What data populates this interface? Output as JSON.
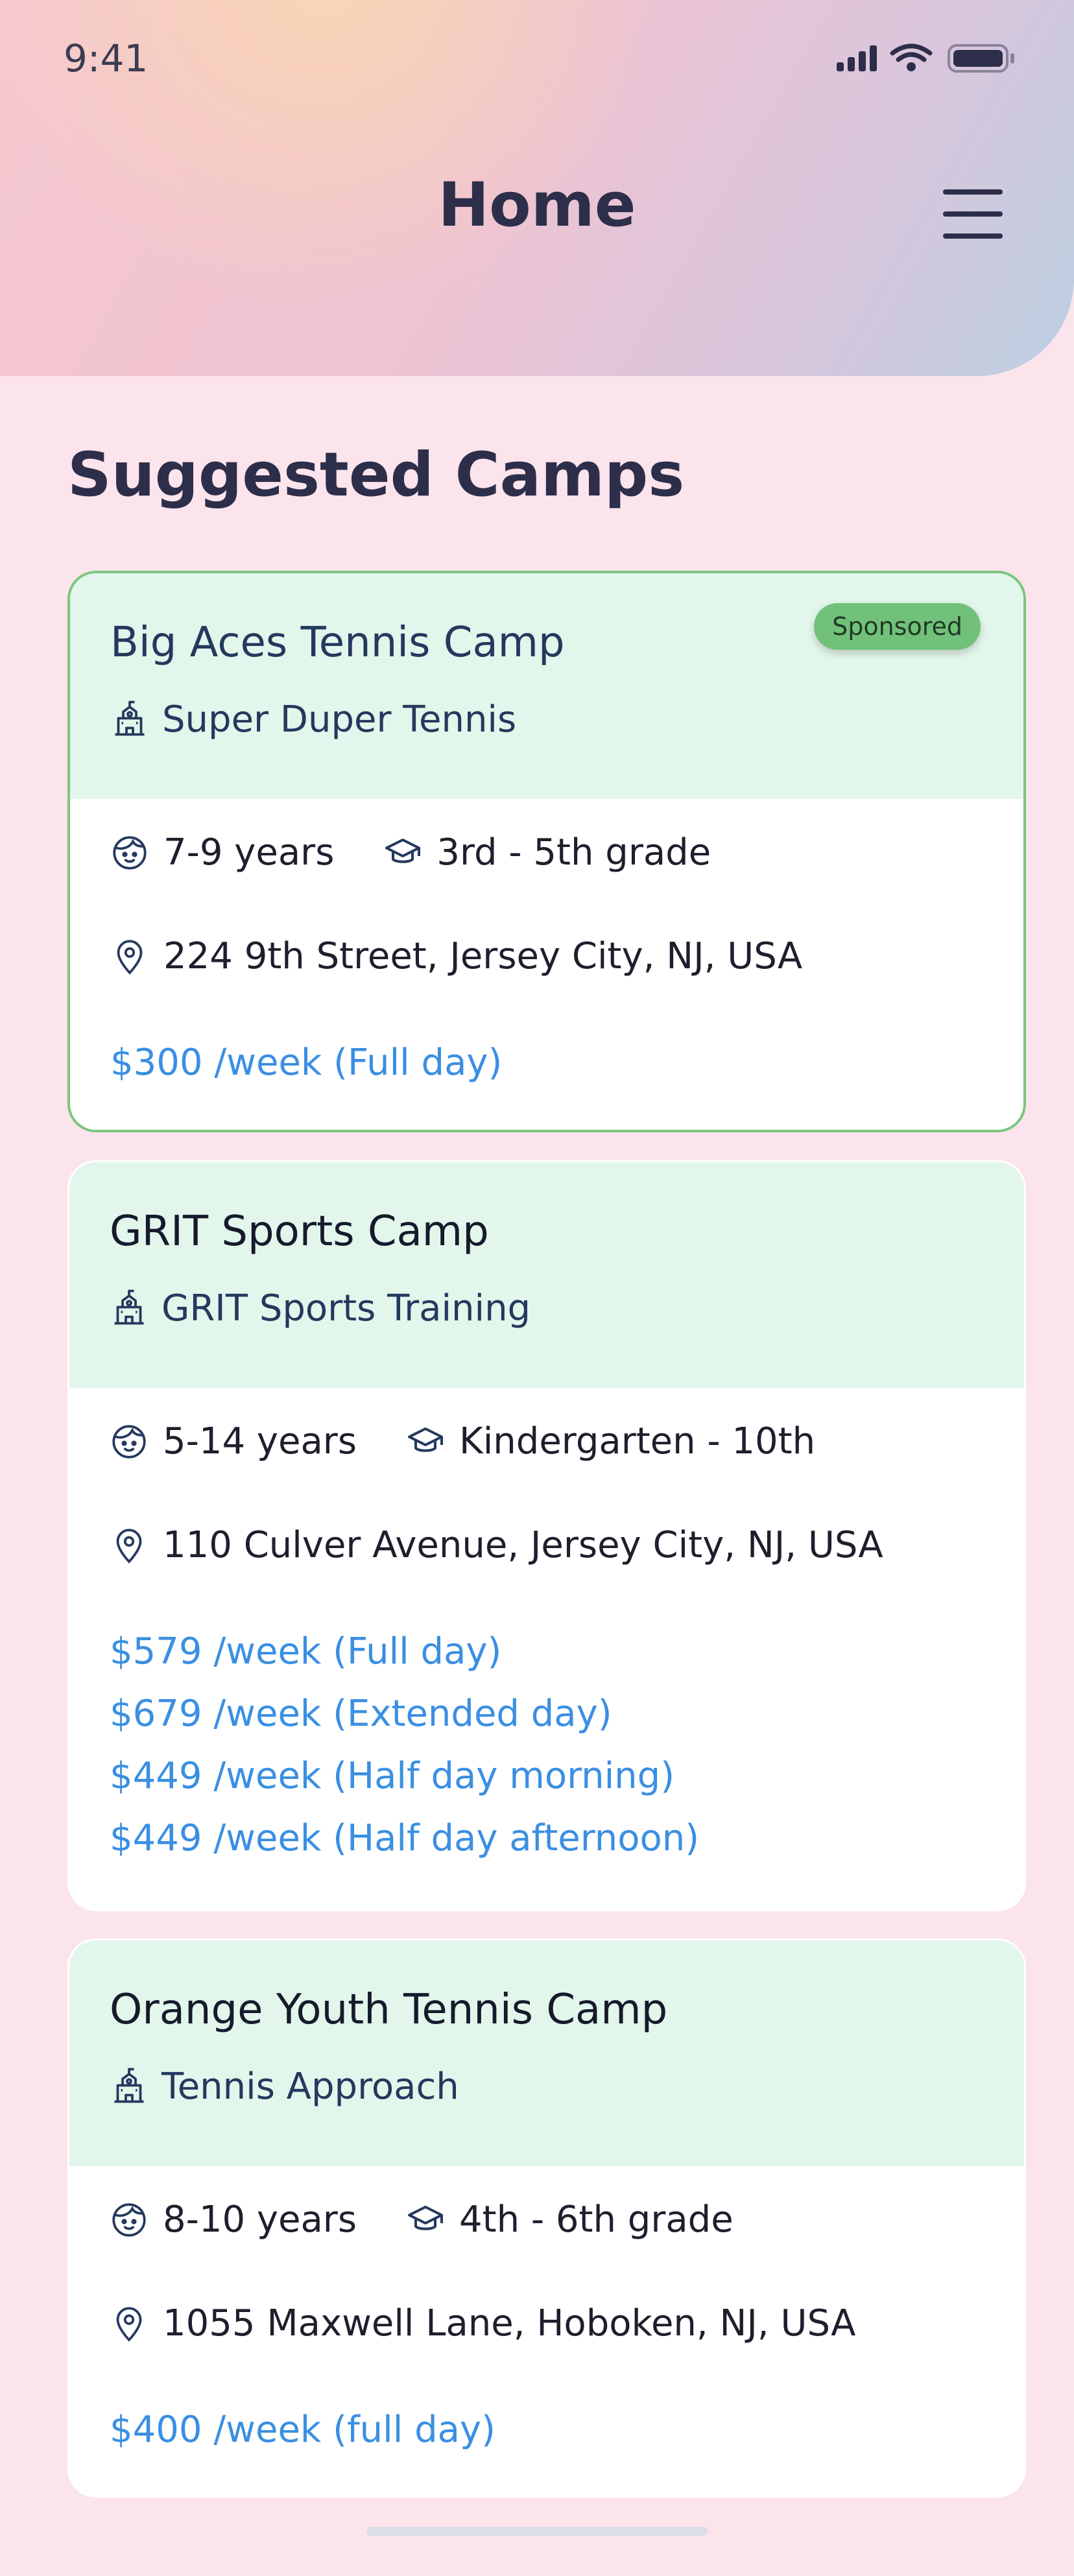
{
  "status_bar": {
    "time": "9:41"
  },
  "header": {
    "title": "Home"
  },
  "section": {
    "title": "Suggested Camps"
  },
  "camps": [
    {
      "title": "Big Aces Tennis Camp",
      "provider": "Super Duper Tennis",
      "badge": "Sponsored",
      "ages": "7-9 years",
      "grades": "3rd - 5th grade",
      "address": "224 9th Street, Jersey City, NJ, USA",
      "prices": [
        "$300 /week (Full day)"
      ]
    },
    {
      "title": "GRIT Sports Camp",
      "provider": "GRIT Sports Training",
      "ages": "5-14 years",
      "grades": "Kindergarten - 10th",
      "address": "110 Culver Avenue, Jersey City, NJ, USA",
      "prices": [
        "$579 /week (Full day)",
        "$679 /week (Extended day)",
        "$449 /week (Half day morning)",
        "$449 /week (Half day afternoon)"
      ]
    },
    {
      "title": "Orange Youth Tennis Camp",
      "provider": "Tennis Approach",
      "ages": "8-10 years",
      "grades": "4th - 6th grade",
      "address": "1055 Maxwell Lane, Hoboken, NJ, USA",
      "prices": [
        "$400 /week (full day)"
      ]
    }
  ],
  "colors": {
    "background": "#fce4ec",
    "card_header": "#e3f6eb",
    "price": "#3a8fe3",
    "sponsored_border": "#7cc67e",
    "badge": "#72c17a",
    "title": "#2d2e4a"
  },
  "icons": {
    "provider": "school-building-icon",
    "ages": "child-face-icon",
    "grades": "graduation-cap-icon",
    "address": "location-pin-icon",
    "menu": "hamburger-menu-icon"
  }
}
